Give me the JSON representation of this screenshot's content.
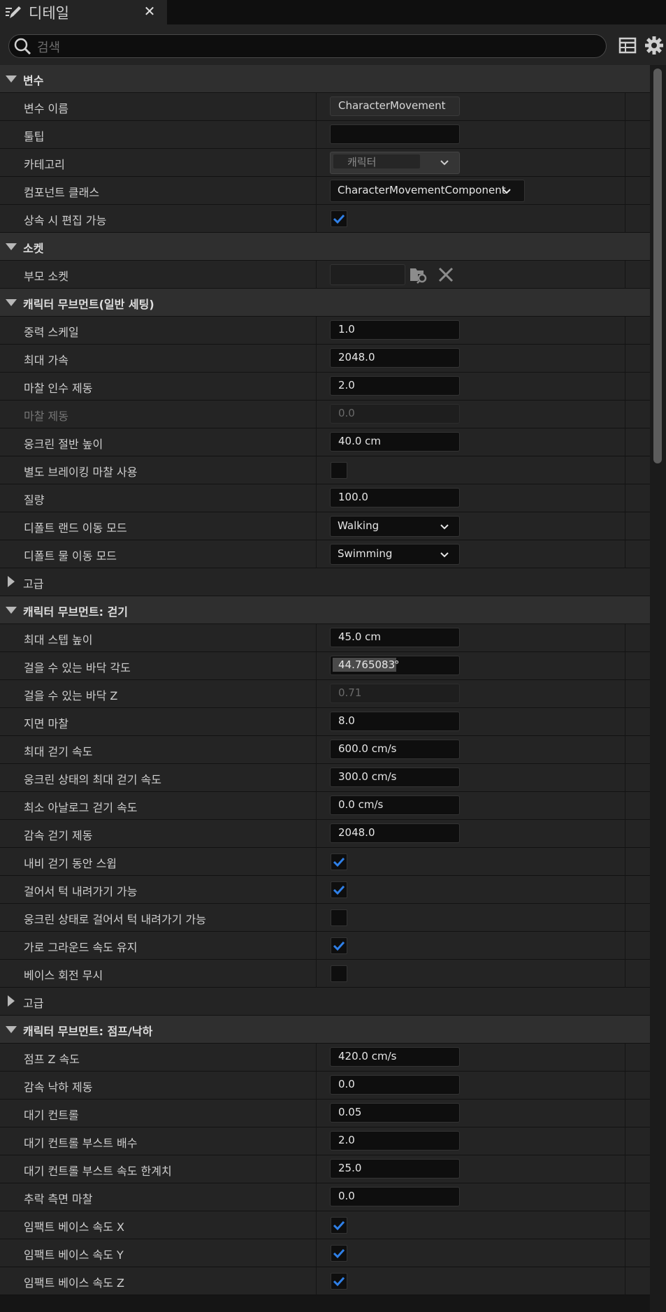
{
  "tab": {
    "title": "디테일",
    "close_glyph": "✕"
  },
  "search": {
    "placeholder": "검색"
  },
  "icons": {
    "tab": "pencil-icon",
    "search": "search-icon",
    "view": "table-icon",
    "settings": "gear-icon"
  },
  "colors": {
    "check": "#2f80e8",
    "panel": "#242424",
    "category": "#2f2f2f"
  },
  "sections": {
    "variable": {
      "title": "변수",
      "rows": [
        {
          "label": "변수 이름",
          "value": "CharacterMovement"
        },
        {
          "label": "툴팁",
          "value": ""
        },
        {
          "label": "카테고리",
          "value": "캐릭터"
        },
        {
          "label": "컴포넌트 클래스",
          "value": "CharacterMovementComponent"
        },
        {
          "label": "상속 시 편집 가능",
          "checked": true
        }
      ]
    },
    "socket": {
      "title": "소켓",
      "rows": [
        {
          "label": "부모 소켓",
          "value": ""
        }
      ]
    },
    "general": {
      "title": "캐릭터 무브먼트(일반 세팅)",
      "rows": [
        {
          "label": "중력 스케일",
          "value": "1.0"
        },
        {
          "label": "최대 가속",
          "value": "2048.0"
        },
        {
          "label": "마찰 인수 제동",
          "value": "2.0"
        },
        {
          "label": "마찰 제동",
          "value": "0.0"
        },
        {
          "label": "웅크린 절반 높이",
          "value": "40.0 cm"
        },
        {
          "label": "별도 브레이킹 마찰 사용",
          "checked": false
        },
        {
          "label": "질량",
          "value": "100.0"
        },
        {
          "label": "디폴트 랜드 이동 모드",
          "value": "Walking"
        },
        {
          "label": "디폴트 물 이동 모드",
          "value": "Swimming"
        }
      ],
      "advanced": "고급"
    },
    "walking": {
      "title": "캐릭터 무브먼트: 걷기",
      "rows": [
        {
          "label": "최대 스텝 높이",
          "value": "45.0 cm"
        },
        {
          "label": "걸을 수 있는 바닥 각도",
          "value": "44.765083",
          "unit": "°"
        },
        {
          "label": "걸을 수 있는 바닥 Z",
          "value": "0.71"
        },
        {
          "label": "지면 마찰",
          "value": "8.0"
        },
        {
          "label": "최대 걷기 속도",
          "value": "600.0 cm/s"
        },
        {
          "label": "웅크린 상태의 최대 걷기 속도",
          "value": "300.0 cm/s"
        },
        {
          "label": "최소 아날로그 걷기 속도",
          "value": "0.0 cm/s"
        },
        {
          "label": "감속 걷기 제동",
          "value": "2048.0"
        },
        {
          "label": "내비 걷기 동안 스윕",
          "checked": true
        },
        {
          "label": "걸어서 턱 내려가기 가능",
          "checked": true
        },
        {
          "label": "웅크린 상태로 걸어서 턱 내려가기 가능",
          "checked": false
        },
        {
          "label": "가로 그라운드 속도 유지",
          "checked": true
        },
        {
          "label": "베이스 회전 무시",
          "checked": false
        }
      ],
      "advanced": "고급"
    },
    "jumping": {
      "title": "캐릭터 무브먼트: 점프/낙하",
      "rows": [
        {
          "label": "점프 Z 속도",
          "value": "420.0 cm/s"
        },
        {
          "label": "감속 낙하 제동",
          "value": "0.0"
        },
        {
          "label": "대기 컨트롤",
          "value": "0.05"
        },
        {
          "label": "대기 컨트롤 부스트 배수",
          "value": "2.0"
        },
        {
          "label": "대기 컨트롤 부스트 속도 한계치",
          "value": "25.0"
        },
        {
          "label": "추락 측면 마찰",
          "value": "0.0"
        },
        {
          "label": "임팩트 베이스 속도 X",
          "checked": true
        },
        {
          "label": "임팩트 베이스 속도 Y",
          "checked": true
        },
        {
          "label": "임팩트 베이스 속도 Z",
          "checked": true
        }
      ]
    }
  }
}
